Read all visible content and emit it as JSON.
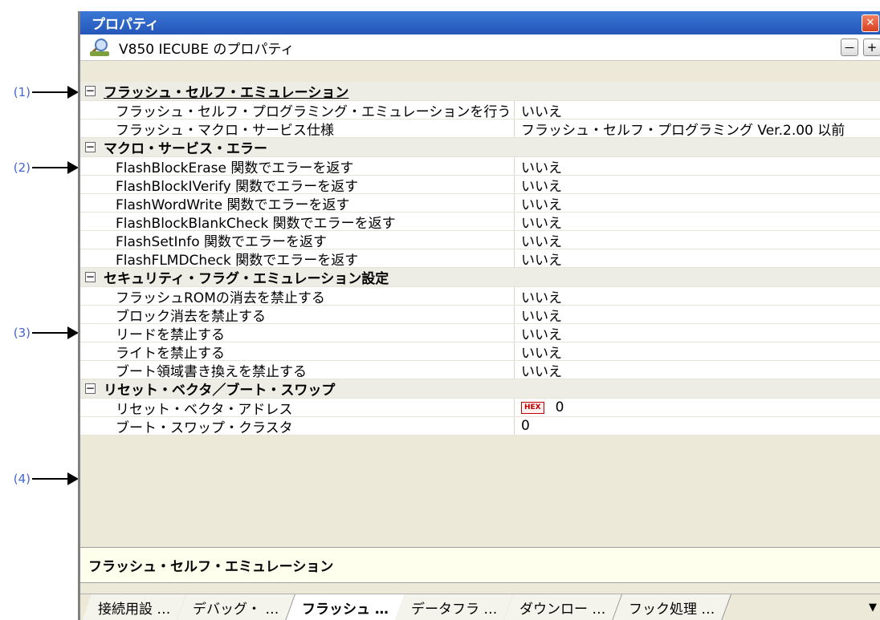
{
  "callouts": [
    "(1)",
    "(2)",
    "(3)",
    "(4)"
  ],
  "window": {
    "title": "プロパティ"
  },
  "header": {
    "title": "V850 IECUBE のプロパティ",
    "collapse_label": "－",
    "expand_label": "+"
  },
  "categories": [
    {
      "name": "フラッシュ・セルフ・エミュレーション",
      "toggle": "－",
      "props": [
        {
          "name": "フラッシュ・セルフ・プログラミング・エミュレーションを行う",
          "value": "いいえ"
        },
        {
          "name": "フラッシュ・マクロ・サービス仕様",
          "value": "フラッシュ・セルフ・プログラミング Ver.2.00 以前"
        }
      ]
    },
    {
      "name": "マクロ・サービス・エラー",
      "toggle": "－",
      "props": [
        {
          "name": "FlashBlockErase 関数でエラーを返す",
          "value": "いいえ"
        },
        {
          "name": "FlashBlockIVerify 関数でエラーを返す",
          "value": "いいえ"
        },
        {
          "name": "FlashWordWrite 関数でエラーを返す",
          "value": "いいえ"
        },
        {
          "name": "FlashBlockBlankCheck 関数でエラーを返す",
          "value": "いいえ"
        },
        {
          "name": "FlashSetInfo 関数でエラーを返す",
          "value": "いいえ"
        },
        {
          "name": "FlashFLMDCheck 関数でエラーを返す",
          "value": "いいえ"
        }
      ]
    },
    {
      "name": "セキュリティ・フラグ・エミュレーション設定",
      "toggle": "－",
      "props": [
        {
          "name": "フラッシュROMの消去を禁止する",
          "value": "いいえ"
        },
        {
          "name": "ブロック消去を禁止する",
          "value": "いいえ"
        },
        {
          "name": "リードを禁止する",
          "value": "いいえ"
        },
        {
          "name": "ライトを禁止する",
          "value": "いいえ"
        },
        {
          "name": "ブート領域書き換えを禁止する",
          "value": "いいえ"
        }
      ]
    },
    {
      "name": "リセット・ベクタ／ブート・スワップ",
      "toggle": "－",
      "props": [
        {
          "name": "リセット・ベクタ・アドレス",
          "value": "0",
          "badge": "HEX"
        },
        {
          "name": "ブート・スワップ・クラスタ",
          "value": "0"
        }
      ]
    }
  ],
  "description": "フラッシュ・セルフ・エミュレーション",
  "tabs": [
    {
      "label": "接続用設 …",
      "active": false
    },
    {
      "label": "デバッグ・ …",
      "active": false
    },
    {
      "label": "フラッシュ …",
      "active": true
    },
    {
      "label": "データフラ …",
      "active": false
    },
    {
      "label": "ダウンロー …",
      "active": false
    },
    {
      "label": "フック処理 …",
      "active": false
    }
  ],
  "tab_menu_icon": "▼"
}
